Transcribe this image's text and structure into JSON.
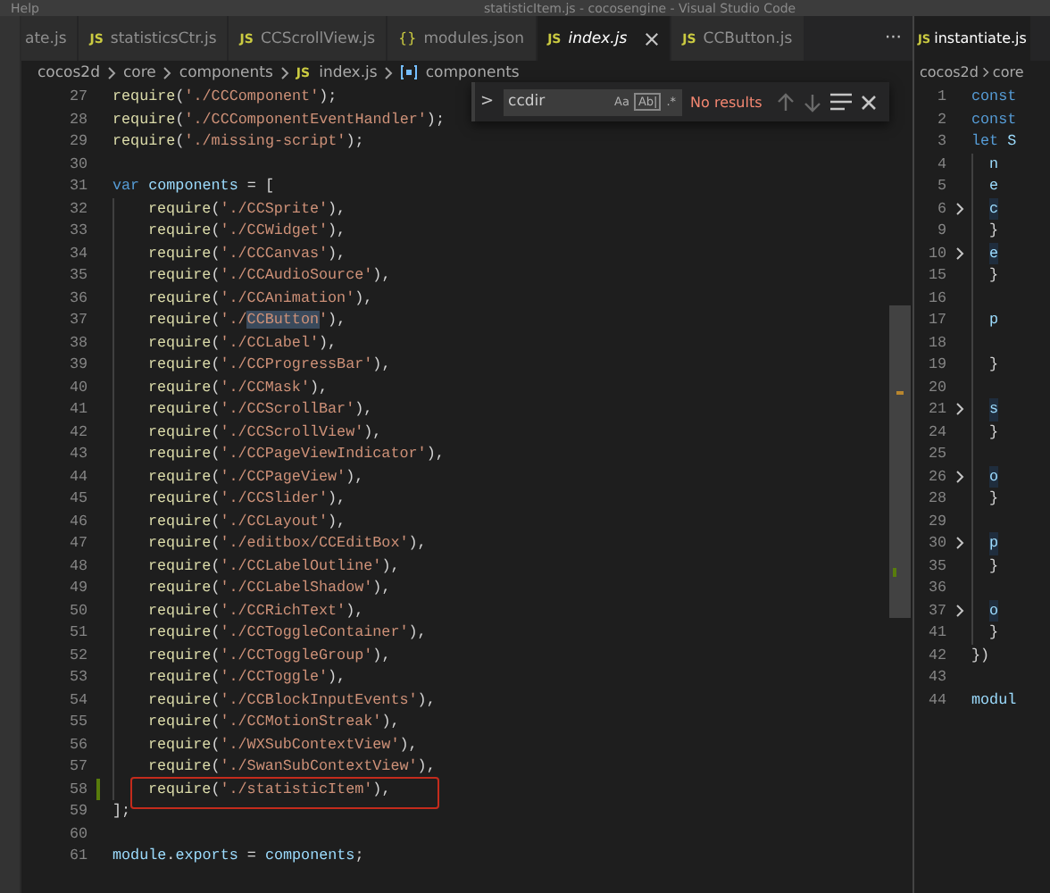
{
  "title_bar": {
    "menu": "Help",
    "title": "statisticItem.js - cocosengine - Visual Studio Code"
  },
  "tabs": [
    {
      "label": "ate.js",
      "selected": false
    },
    {
      "badge": "JS",
      "label": "statisticsCtr.js",
      "selected": false
    },
    {
      "badge": "JS",
      "label": "CCScrollView.js",
      "selected": false
    },
    {
      "badge": "{}",
      "label": "modules.json",
      "selected": false
    },
    {
      "badge": "JS",
      "label": "index.js",
      "selected": true
    },
    {
      "badge": "JS",
      "label": "CCButton.js",
      "selected": false
    }
  ],
  "tabs_more": "···",
  "breadcrumb": [
    {
      "kind": "folder",
      "label": "cocos2d"
    },
    {
      "kind": "folder",
      "label": "core"
    },
    {
      "kind": "folder",
      "label": "components"
    },
    {
      "kind": "file",
      "badge": "JS",
      "label": "index.js"
    },
    {
      "kind": "symbol",
      "label": "components"
    }
  ],
  "find": {
    "toggle": ">",
    "value": "ccdir",
    "options": [
      "Aa",
      "Ab|",
      ".*"
    ],
    "status": "No results"
  },
  "lines": [
    {
      "n": "27",
      "added": false,
      "boxed": false,
      "tokens": [
        {
          "kind": "fn",
          "text": "require"
        },
        {
          "kind": "p",
          "text": "("
        },
        {
          "kind": "s",
          "text": "'./CCComponent'"
        },
        {
          "kind": "p",
          "text": ");"
        }
      ]
    },
    {
      "n": "28",
      "added": false,
      "boxed": false,
      "tokens": [
        {
          "kind": "fn",
          "text": "require"
        },
        {
          "kind": "p",
          "text": "("
        },
        {
          "kind": "s",
          "text": "'./CCComponentEventHandler'"
        },
        {
          "kind": "p",
          "text": ");"
        }
      ]
    },
    {
      "n": "29",
      "added": false,
      "boxed": false,
      "tokens": [
        {
          "kind": "fn",
          "text": "require"
        },
        {
          "kind": "p",
          "text": "("
        },
        {
          "kind": "s",
          "text": "'./missing-script'"
        },
        {
          "kind": "p",
          "text": ");"
        }
      ]
    },
    {
      "n": "30",
      "added": false,
      "boxed": false
    },
    {
      "n": "31",
      "added": false,
      "boxed": false,
      "tokens": [
        {
          "kind": "kw",
          "text": "var"
        },
        {
          "kind": "v",
          "text": " components"
        },
        {
          "kind": "p",
          "text": " = ["
        }
      ],
      "children": [
        {
          "n": "32",
          "added": false,
          "boxed": false,
          "tokens": [
            {
              "kind": "fn",
              "text": "require"
            },
            {
              "kind": "p",
              "text": "("
            },
            {
              "kind": "s",
              "text": "'./CCSprite'"
            },
            {
              "kind": "p",
              "text": "),"
            }
          ]
        },
        {
          "n": "33",
          "added": false,
          "boxed": false,
          "tokens": [
            {
              "kind": "fn",
              "text": "require"
            },
            {
              "kind": "p",
              "text": "("
            },
            {
              "kind": "s",
              "text": "'./CCWidget'"
            },
            {
              "kind": "p",
              "text": "),"
            }
          ]
        },
        {
          "n": "34",
          "added": false,
          "boxed": false,
          "tokens": [
            {
              "kind": "fn",
              "text": "require"
            },
            {
              "kind": "p",
              "text": "("
            },
            {
              "kind": "s",
              "text": "'./CCCanvas'"
            },
            {
              "kind": "p",
              "text": "),"
            }
          ]
        },
        {
          "n": "35",
          "added": false,
          "boxed": false,
          "tokens": [
            {
              "kind": "fn",
              "text": "require"
            },
            {
              "kind": "p",
              "text": "("
            },
            {
              "kind": "s",
              "text": "'./CCAudioSource'"
            },
            {
              "kind": "p",
              "text": "),"
            }
          ]
        },
        {
          "n": "36",
          "added": false,
          "boxed": false,
          "tokens": [
            {
              "kind": "fn",
              "text": "require"
            },
            {
              "kind": "p",
              "text": "("
            },
            {
              "kind": "s",
              "text": "'./CCAnimation'"
            },
            {
              "kind": "p",
              "text": "),"
            }
          ]
        },
        {
          "n": "37",
          "added": false,
          "boxed": false,
          "tokens": [
            {
              "kind": "fn",
              "text": "require"
            },
            {
              "kind": "p",
              "text": "("
            },
            {
              "kind": "s",
              "text": "'./"
            },
            {
              "kind": "hl",
              "text": "CCButton"
            },
            {
              "kind": "s",
              "text": "'"
            },
            {
              "kind": "p",
              "text": "),"
            }
          ]
        },
        {
          "n": "38",
          "added": false,
          "boxed": false,
          "tokens": [
            {
              "kind": "fn",
              "text": "require"
            },
            {
              "kind": "p",
              "text": "("
            },
            {
              "kind": "s",
              "text": "'./CCLabel'"
            },
            {
              "kind": "p",
              "text": "),"
            }
          ]
        },
        {
          "n": "39",
          "added": false,
          "boxed": false,
          "tokens": [
            {
              "kind": "fn",
              "text": "require"
            },
            {
              "kind": "p",
              "text": "("
            },
            {
              "kind": "s",
              "text": "'./CCProgressBar'"
            },
            {
              "kind": "p",
              "text": "),"
            }
          ]
        },
        {
          "n": "40",
          "added": false,
          "boxed": false,
          "tokens": [
            {
              "kind": "fn",
              "text": "require"
            },
            {
              "kind": "p",
              "text": "("
            },
            {
              "kind": "s",
              "text": "'./CCMask'"
            },
            {
              "kind": "p",
              "text": "),"
            }
          ]
        },
        {
          "n": "41",
          "added": false,
          "boxed": false,
          "tokens": [
            {
              "kind": "fn",
              "text": "require"
            },
            {
              "kind": "p",
              "text": "("
            },
            {
              "kind": "s",
              "text": "'./CCScrollBar'"
            },
            {
              "kind": "p",
              "text": "),"
            }
          ]
        },
        {
          "n": "42",
          "added": false,
          "boxed": false,
          "tokens": [
            {
              "kind": "fn",
              "text": "require"
            },
            {
              "kind": "p",
              "text": "("
            },
            {
              "kind": "s",
              "text": "'./CCScrollView'"
            },
            {
              "kind": "p",
              "text": "),"
            }
          ]
        },
        {
          "n": "43",
          "added": false,
          "boxed": false,
          "tokens": [
            {
              "kind": "fn",
              "text": "require"
            },
            {
              "kind": "p",
              "text": "("
            },
            {
              "kind": "s",
              "text": "'./CCPageViewIndicator'"
            },
            {
              "kind": "p",
              "text": "),"
            }
          ]
        },
        {
          "n": "44",
          "added": false,
          "boxed": false,
          "tokens": [
            {
              "kind": "fn",
              "text": "require"
            },
            {
              "kind": "p",
              "text": "("
            },
            {
              "kind": "s",
              "text": "'./CCPageView'"
            },
            {
              "kind": "p",
              "text": "),"
            }
          ]
        },
        {
          "n": "45",
          "added": false,
          "boxed": false,
          "tokens": [
            {
              "kind": "fn",
              "text": "require"
            },
            {
              "kind": "p",
              "text": "("
            },
            {
              "kind": "s",
              "text": "'./CCSlider'"
            },
            {
              "kind": "p",
              "text": "),"
            }
          ]
        },
        {
          "n": "46",
          "added": false,
          "boxed": false,
          "tokens": [
            {
              "kind": "fn",
              "text": "require"
            },
            {
              "kind": "p",
              "text": "("
            },
            {
              "kind": "s",
              "text": "'./CCLayout'"
            },
            {
              "kind": "p",
              "text": "),"
            }
          ]
        },
        {
          "n": "47",
          "added": false,
          "boxed": false,
          "tokens": [
            {
              "kind": "fn",
              "text": "require"
            },
            {
              "kind": "p",
              "text": "("
            },
            {
              "kind": "s",
              "text": "'./editbox/CCEditBox'"
            },
            {
              "kind": "p",
              "text": "),"
            }
          ]
        },
        {
          "n": "48",
          "added": false,
          "boxed": false,
          "tokens": [
            {
              "kind": "fn",
              "text": "require"
            },
            {
              "kind": "p",
              "text": "("
            },
            {
              "kind": "s",
              "text": "'./CCLabelOutline'"
            },
            {
              "kind": "p",
              "text": "),"
            }
          ]
        },
        {
          "n": "49",
          "added": false,
          "boxed": false,
          "tokens": [
            {
              "kind": "fn",
              "text": "require"
            },
            {
              "kind": "p",
              "text": "("
            },
            {
              "kind": "s",
              "text": "'./CCLabelShadow'"
            },
            {
              "kind": "p",
              "text": "),"
            }
          ]
        },
        {
          "n": "50",
          "added": false,
          "boxed": false,
          "tokens": [
            {
              "kind": "fn",
              "text": "require"
            },
            {
              "kind": "p",
              "text": "("
            },
            {
              "kind": "s",
              "text": "'./CCRichText'"
            },
            {
              "kind": "p",
              "text": "),"
            }
          ]
        },
        {
          "n": "51",
          "added": false,
          "boxed": false,
          "tokens": [
            {
              "kind": "fn",
              "text": "require"
            },
            {
              "kind": "p",
              "text": "("
            },
            {
              "kind": "s",
              "text": "'./CCToggleContainer'"
            },
            {
              "kind": "p",
              "text": "),"
            }
          ]
        },
        {
          "n": "52",
          "added": false,
          "boxed": false,
          "tokens": [
            {
              "kind": "fn",
              "text": "require"
            },
            {
              "kind": "p",
              "text": "("
            },
            {
              "kind": "s",
              "text": "'./CCToggleGroup'"
            },
            {
              "kind": "p",
              "text": "),"
            }
          ]
        },
        {
          "n": "53",
          "added": false,
          "boxed": false,
          "tokens": [
            {
              "kind": "fn",
              "text": "require"
            },
            {
              "kind": "p",
              "text": "("
            },
            {
              "kind": "s",
              "text": "'./CCToggle'"
            },
            {
              "kind": "p",
              "text": "),"
            }
          ]
        },
        {
          "n": "54",
          "added": false,
          "boxed": false,
          "tokens": [
            {
              "kind": "fn",
              "text": "require"
            },
            {
              "kind": "p",
              "text": "("
            },
            {
              "kind": "s",
              "text": "'./CCBlockInputEvents'"
            },
            {
              "kind": "p",
              "text": "),"
            }
          ]
        },
        {
          "n": "55",
          "added": false,
          "boxed": false,
          "tokens": [
            {
              "kind": "fn",
              "text": "require"
            },
            {
              "kind": "p",
              "text": "("
            },
            {
              "kind": "s",
              "text": "'./CCMotionStreak'"
            },
            {
              "kind": "p",
              "text": "),"
            }
          ]
        },
        {
          "n": "56",
          "added": false,
          "boxed": false,
          "tokens": [
            {
              "kind": "fn",
              "text": "require"
            },
            {
              "kind": "p",
              "text": "("
            },
            {
              "kind": "s",
              "text": "'./WXSubContextView'"
            },
            {
              "kind": "p",
              "text": "),"
            }
          ]
        },
        {
          "n": "57",
          "added": false,
          "boxed": false,
          "tokens": [
            {
              "kind": "fn",
              "text": "require"
            },
            {
              "kind": "p",
              "text": "("
            },
            {
              "kind": "s",
              "text": "'./SwanSubContextView'"
            },
            {
              "kind": "p",
              "text": "),"
            }
          ]
        },
        {
          "n": "58",
          "added": true,
          "boxed": true,
          "tokens": [
            {
              "kind": "fn",
              "text": "require"
            },
            {
              "kind": "p",
              "text": "("
            },
            {
              "kind": "s",
              "text": "'./statisticItem'"
            },
            {
              "kind": "p",
              "text": "),"
            }
          ]
        }
      ]
    },
    {
      "n": "59",
      "added": false,
      "boxed": false,
      "tokens": [
        {
          "kind": "p",
          "text": "];"
        }
      ]
    },
    {
      "n": "60",
      "added": false,
      "boxed": false
    },
    {
      "n": "61",
      "added": false,
      "boxed": false,
      "tokens": [
        {
          "kind": "v",
          "text": "module"
        },
        {
          "kind": "p",
          "text": "."
        },
        {
          "kind": "v",
          "text": "exports"
        },
        {
          "kind": "p",
          "text": " = "
        },
        {
          "kind": "v",
          "text": "components"
        },
        {
          "kind": "p",
          "text": ";"
        }
      ]
    }
  ],
  "side_pane": {
    "tab": {
      "badge": "JS",
      "label": "instantiate.js"
    },
    "breadcrumb": [
      {
        "label": "cocos2d"
      },
      {
        "label": "core"
      }
    ],
    "lines": [
      {
        "n": "1",
        "folded": false,
        "tokens": [
          {
            "kind": "kw",
            "text": "const"
          }
        ]
      },
      {
        "n": "2",
        "folded": false,
        "tokens": [
          {
            "kind": "kw",
            "text": "const"
          }
        ]
      },
      {
        "n": "3",
        "folded": false,
        "tokens": [
          {
            "kind": "kw",
            "text": "let"
          },
          {
            "kind": "v",
            "text": " S"
          }
        ],
        "children": [
          {
            "n": "4",
            "folded": false,
            "tokens": [
              {
                "kind": "v",
                "text": "n"
              }
            ]
          },
          {
            "n": "5",
            "folded": false,
            "tokens": [
              {
                "kind": "v",
                "text": "e"
              }
            ]
          },
          {
            "n": "6",
            "folded": true,
            "tokens": [
              {
                "kind": "v",
                "text": "c"
              }
            ]
          },
          {
            "n": "9",
            "folded": false,
            "tokens": [
              {
                "kind": "p",
                "text": "}"
              }
            ]
          },
          {
            "n": "10",
            "folded": true,
            "tokens": [
              {
                "kind": "v",
                "text": "e"
              }
            ]
          },
          {
            "n": "15",
            "folded": false,
            "tokens": [
              {
                "kind": "p",
                "text": "}"
              }
            ]
          },
          {
            "n": "16",
            "folded": false
          },
          {
            "n": "17",
            "folded": false,
            "tokens": [
              {
                "kind": "v",
                "text": "p"
              }
            ]
          },
          {
            "n": "18",
            "folded": false
          },
          {
            "n": "19",
            "folded": false,
            "tokens": [
              {
                "kind": "p",
                "text": "}"
              }
            ]
          },
          {
            "n": "20",
            "folded": false
          },
          {
            "n": "21",
            "folded": true,
            "tokens": [
              {
                "kind": "v",
                "text": "s"
              }
            ]
          },
          {
            "n": "24",
            "folded": false,
            "tokens": [
              {
                "kind": "p",
                "text": "}"
              }
            ]
          },
          {
            "n": "25",
            "folded": false
          },
          {
            "n": "26",
            "folded": true,
            "tokens": [
              {
                "kind": "v",
                "text": "o"
              }
            ]
          },
          {
            "n": "28",
            "folded": false,
            "tokens": [
              {
                "kind": "p",
                "text": "}"
              }
            ]
          },
          {
            "n": "29",
            "folded": false
          },
          {
            "n": "30",
            "folded": true,
            "tokens": [
              {
                "kind": "v",
                "text": "p"
              }
            ]
          },
          {
            "n": "35",
            "folded": false,
            "tokens": [
              {
                "kind": "p",
                "text": "}"
              }
            ]
          },
          {
            "n": "36",
            "folded": false
          },
          {
            "n": "37",
            "folded": true,
            "tokens": [
              {
                "kind": "v",
                "text": "o"
              }
            ]
          },
          {
            "n": "41",
            "folded": false,
            "tokens": [
              {
                "kind": "p",
                "text": "}"
              }
            ]
          }
        ]
      },
      {
        "n": "42",
        "folded": false,
        "tokens": [
          {
            "kind": "p",
            "text": "})"
          }
        ]
      },
      {
        "n": "43",
        "folded": false
      },
      {
        "n": "44",
        "folded": false,
        "tokens": [
          {
            "kind": "v",
            "text": "modul"
          }
        ]
      }
    ]
  }
}
